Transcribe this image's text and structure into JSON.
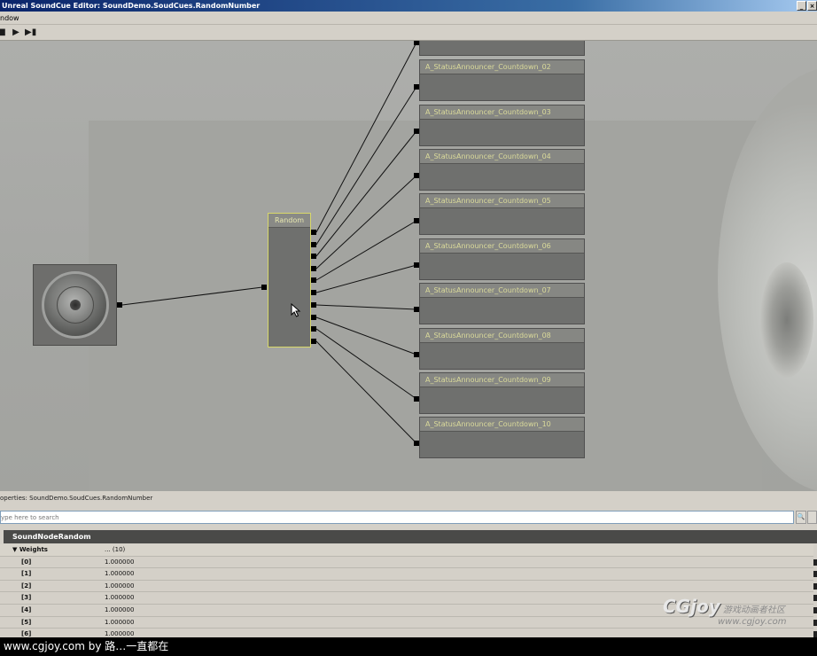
{
  "window": {
    "title": "Unreal SoundCue Editor: SoundDemo.SoudCues.RandomNumber",
    "minimize": "_",
    "close": "×"
  },
  "menu": {
    "window_label": "ndow"
  },
  "toolbar": {
    "buttons": [
      "stop-icon",
      "play-icon",
      "play-node-icon"
    ]
  },
  "graph": {
    "random_node": {
      "title": "Random"
    },
    "wave_nodes": [
      "A_StatusAnnouncer_Countdown_02",
      "A_StatusAnnouncer_Countdown_03",
      "A_StatusAnnouncer_Countdown_04",
      "A_StatusAnnouncer_Countdown_05",
      "A_StatusAnnouncer_Countdown_06",
      "A_StatusAnnouncer_Countdown_07",
      "A_StatusAnnouncer_Countdown_08",
      "A_StatusAnnouncer_Countdown_09",
      "A_StatusAnnouncer_Countdown_10"
    ]
  },
  "properties": {
    "label": "operties: SoundDemo.SoudCues.RandomNumber",
    "search_placeholder": "ype here to search",
    "section": "SoundNodeRandom",
    "weights_label": "Weights",
    "weights_value": "... (10)",
    "rows": [
      {
        "key": "[0]",
        "value": "1.000000"
      },
      {
        "key": "[1]",
        "value": "1.000000"
      },
      {
        "key": "[2]",
        "value": "1.000000"
      },
      {
        "key": "[3]",
        "value": "1.000000"
      },
      {
        "key": "[4]",
        "value": "1.000000"
      },
      {
        "key": "[5]",
        "value": "1.000000"
      },
      {
        "key": "[6]",
        "value": "1.000000"
      }
    ]
  },
  "watermark": {
    "logo": "CGjoy",
    "chinese": "游戏动画者社区",
    "url": "www.cgjoy.com"
  },
  "footer": {
    "text": "www.cgjoy.com by 路…一直都在"
  }
}
